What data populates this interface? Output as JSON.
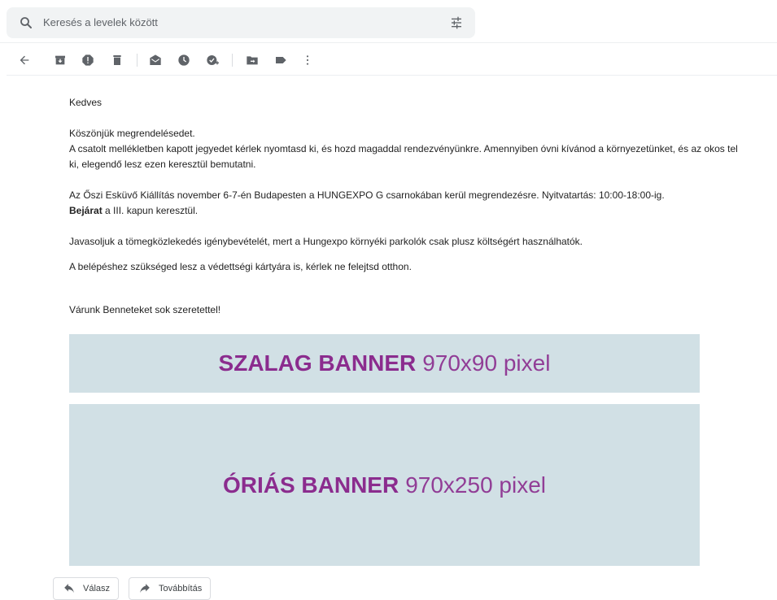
{
  "search": {
    "placeholder": "Keresés a levelek között"
  },
  "toolbar": {
    "icons": [
      "back-arrow-icon",
      "archive-icon",
      "report-spam-icon",
      "delete-icon",
      "mark-unread-icon",
      "snooze-icon",
      "add-task-icon",
      "move-to-icon",
      "label-icon",
      "more-options-icon"
    ]
  },
  "email": {
    "greeting": "Kedves",
    "thanks": "Köszönjük megrendelésedet.",
    "para1_line1": "A csatolt mellékletben kapott jegyedet kérlek nyomtasd ki, és hozd magaddal rendezvényünkre. Amennyiben óvni kívánod a környezetünket, és az okos tel",
    "para1_line2": "ki, elegendő lesz ezen keresztül bemutatni.",
    "para2_line1": "Az Őszi Esküvő Kiállítás november 6-7-én Budapesten a HUNGEXPO G csarnokában kerül megrendezésre. Nyitvatartás: 10:00-18:00-ig.",
    "para2_bold": "Bejárat",
    "para2_rest": " a III. kapun keresztül.",
    "para3": "Javasoljuk a tömegközlekedés igénybevételét, mert a Hungexpo környéki parkolók csak plusz költségért használhatók.",
    "para4": "A belépéshez szükséged lesz a védettségi kártyára is, kérlek ne felejtsd otthon.",
    "closing": "Várunk Benneteket sok szeretettel!"
  },
  "banners": {
    "top": {
      "bold": "SZALAG BANNER",
      "light": "970x90 pixel"
    },
    "big": {
      "bold": "ÓRIÁS BANNER",
      "light": "970x250 pixel"
    }
  },
  "actions": {
    "reply": "Válasz",
    "forward": "Továbbítás"
  },
  "colors": {
    "banner_bg": "#d1e0e5",
    "banner_text": "#8b2c8e",
    "search_bg": "#f1f3f4"
  }
}
